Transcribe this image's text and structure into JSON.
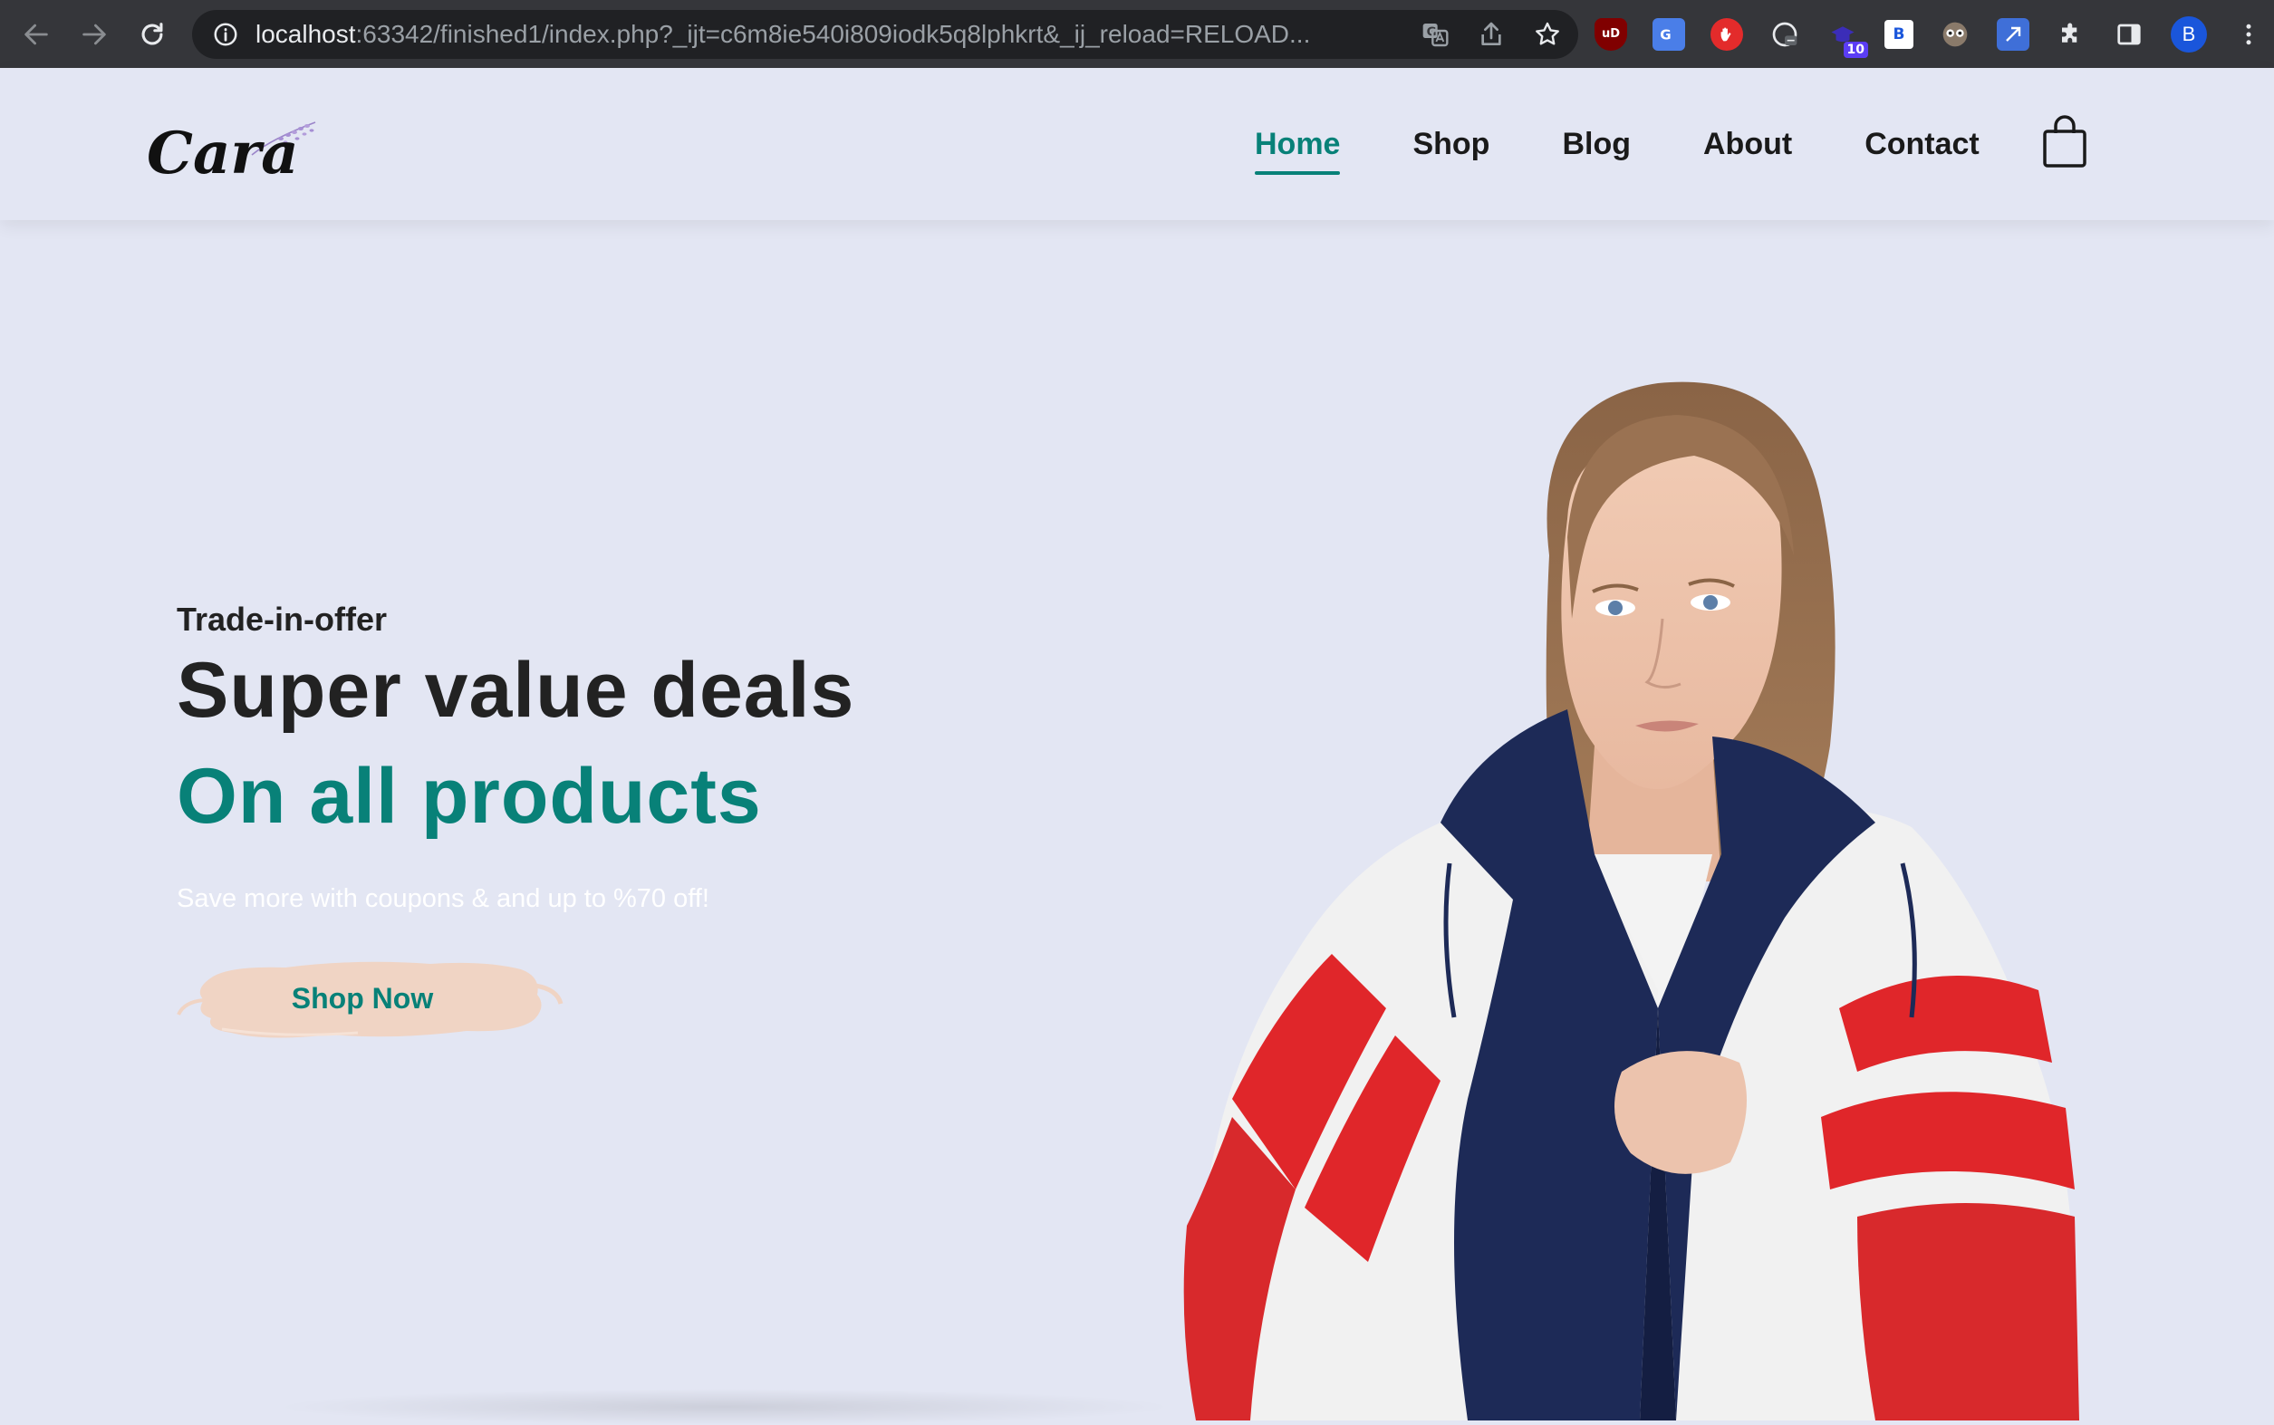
{
  "browser": {
    "url_host": "localhost",
    "url_rest": ":63342/finished1/index.php?_ijt=c6m8ie540i809iodk5q8lphkrt&_ij_reload=RELOAD...",
    "profile_initial": "B",
    "extension_badge": "10",
    "extension_b_label": "B",
    "extension_ublock_label": "uD"
  },
  "site": {
    "logo_text": "Cara",
    "nav": {
      "home": "Home",
      "shop": "Shop",
      "blog": "Blog",
      "about": "About",
      "contact": "Contact"
    }
  },
  "hero": {
    "eyebrow": "Trade-in-offer",
    "headline": "Super value deals",
    "subheadline": "On all products",
    "tagline": "Save more with coupons & and up to %70 off!",
    "button_label": "Shop Now"
  },
  "colors": {
    "accent": "#088178",
    "background": "#e3e6f3",
    "button_brush": "#f0d4c4",
    "jacket_navy": "#1d2a57",
    "jacket_red": "#e0262a"
  },
  "icons": {
    "back": "arrow-left-icon",
    "forward": "arrow-right-icon",
    "reload": "reload-icon",
    "info": "info-icon",
    "translate": "translate-icon",
    "share": "share-icon",
    "bookmark": "star-icon",
    "cart": "shopping-bag-icon"
  }
}
